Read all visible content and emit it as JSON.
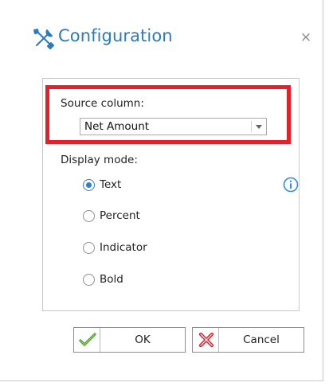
{
  "dialog": {
    "title": "Configuration",
    "close_glyph": "×",
    "title_icon": "tools-icon",
    "accent_color": "#2b7bbf"
  },
  "source_column": {
    "label": "Source column:",
    "selected": "Net Amount",
    "highlight_color": "#e4202b"
  },
  "display_mode": {
    "label": "Display mode:",
    "options": [
      {
        "label": "Text",
        "checked": true
      },
      {
        "label": "Percent",
        "checked": false
      },
      {
        "label": "Indicator",
        "checked": false
      },
      {
        "label": "Bold",
        "checked": false
      }
    ],
    "info_icon": "info-icon"
  },
  "buttons": {
    "ok_label": "OK",
    "cancel_label": "Cancel"
  }
}
